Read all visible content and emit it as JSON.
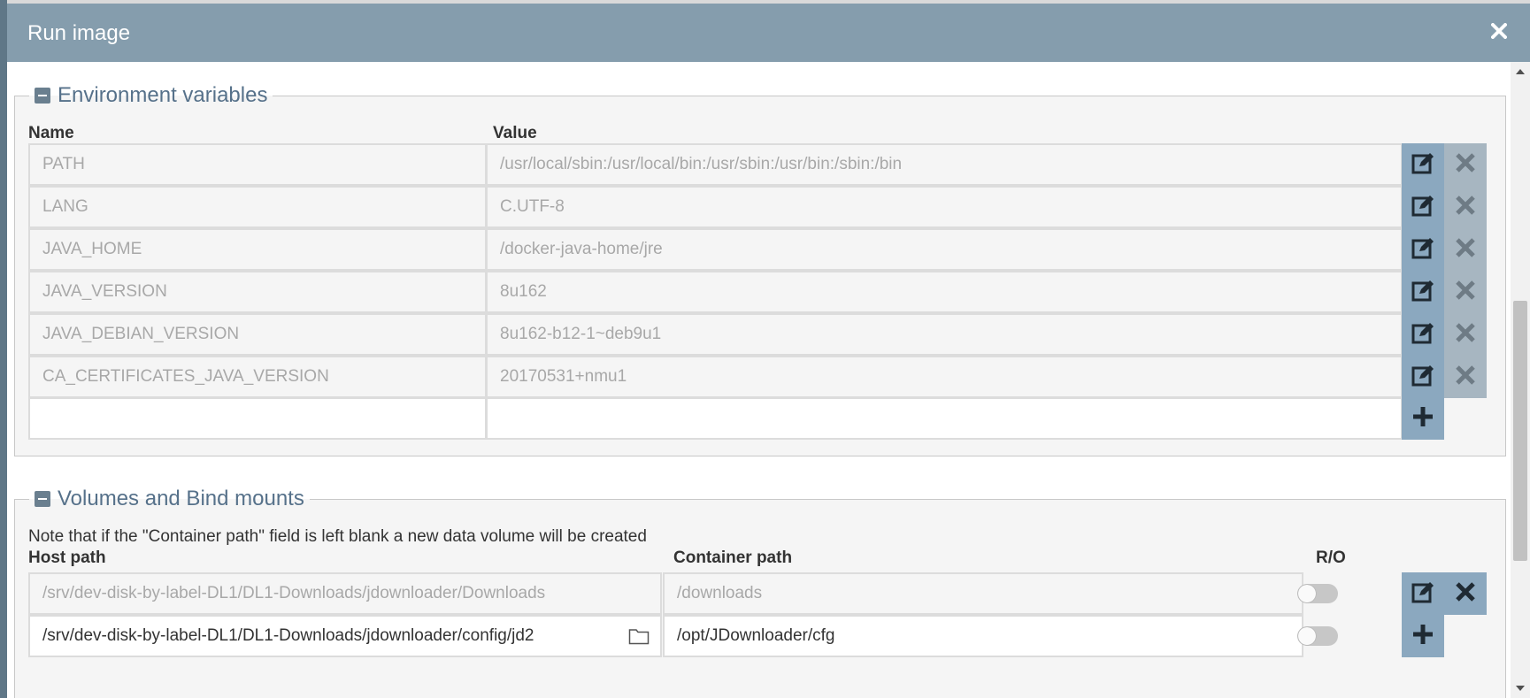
{
  "dialog": {
    "title": "Run image",
    "close_icon": "close-icon"
  },
  "env": {
    "legend": "Environment variables",
    "headers": {
      "name": "Name",
      "value": "Value"
    },
    "rows": [
      {
        "name": "PATH",
        "value": "/usr/local/sbin:/usr/local/bin:/usr/sbin:/usr/bin:/sbin:/bin"
      },
      {
        "name": "LANG",
        "value": "C.UTF-8"
      },
      {
        "name": "JAVA_HOME",
        "value": "/docker-java-home/jre"
      },
      {
        "name": "JAVA_VERSION",
        "value": "8u162"
      },
      {
        "name": "JAVA_DEBIAN_VERSION",
        "value": "8u162-b12-1~deb9u1"
      },
      {
        "name": "CA_CERTIFICATES_JAVA_VERSION",
        "value": "20170531+nmu1"
      }
    ],
    "new_row": {
      "name": "",
      "value": ""
    }
  },
  "volumes": {
    "legend": "Volumes and Bind mounts",
    "note": "Note that if the \"Container path\" field is left blank a new data volume will be created",
    "headers": {
      "host": "Host path",
      "container": "Container path",
      "ro": "R/O"
    },
    "rows": [
      {
        "host": "/srv/dev-disk-by-label-DL1/DL1-Downloads/jdownloader/Downloads",
        "container": "/downloads",
        "ro": false
      }
    ],
    "new_row": {
      "host": "/srv/dev-disk-by-label-DL1/DL1-Downloads/jdownloader/config/jd2",
      "container": "/opt/JDownloader/cfg",
      "ro": false
    }
  },
  "colors": {
    "titlebar": "#859dad",
    "edit_button": "#8ba8bf",
    "delete_button": "#a7b6c1",
    "legend_text": "#56718a"
  }
}
